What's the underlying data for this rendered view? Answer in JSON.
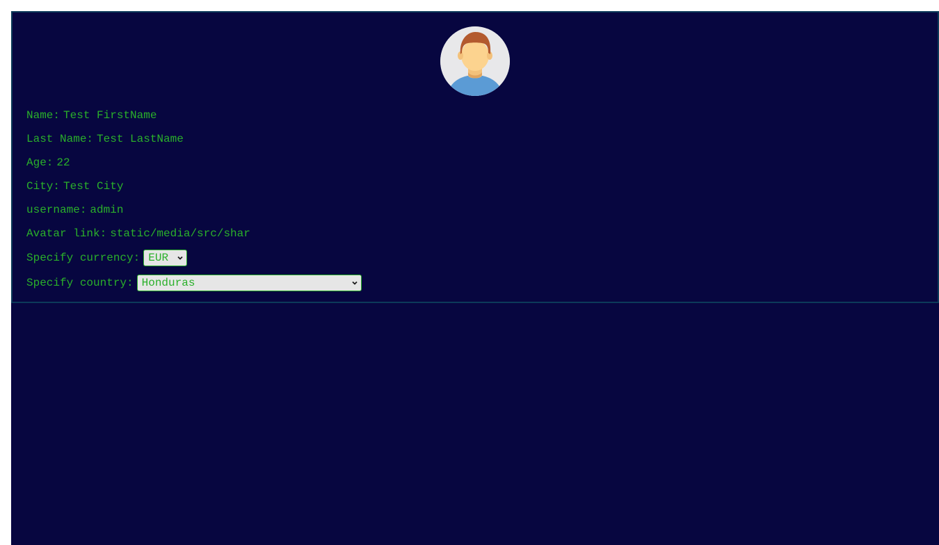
{
  "profile": {
    "avatar_icon": "user-avatar-icon",
    "fields": {
      "name": {
        "label": "Name:",
        "value": "Test FirstName"
      },
      "last_name": {
        "label": "Last Name:",
        "value": "Test LastName"
      },
      "age": {
        "label": "Age:",
        "value": "22"
      },
      "city": {
        "label": "City:",
        "value": "Test City"
      },
      "username": {
        "label": "username:",
        "value": "admin"
      },
      "avatar_link": {
        "label": "Avatar link:",
        "value": "static/media/src/shar"
      }
    },
    "currency": {
      "label": "Specify currency:",
      "selected": "EUR"
    },
    "country": {
      "label": "Specify country:",
      "selected": "Honduras"
    }
  },
  "colors": {
    "background": "#070640",
    "text": "#2ab02a",
    "border": "#0c3a5a",
    "select_bg": "#e6e6e6"
  }
}
